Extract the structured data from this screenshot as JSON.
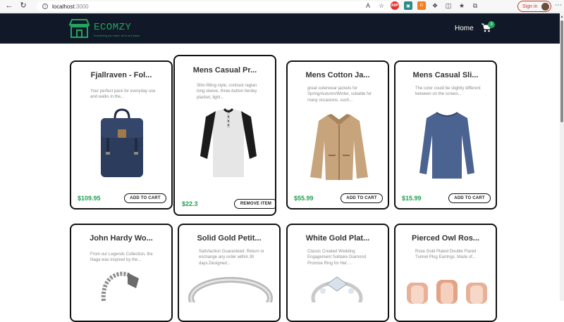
{
  "browser": {
    "url_host": "localhost",
    "url_port": ":3000",
    "signin_label": "Sign in",
    "ext_red": "ABP",
    "ext_teal": "▣",
    "ext_orange": "G"
  },
  "navbar": {
    "logo_name": "ECOMZY",
    "logo_tagline": "Everything you need, all in one place",
    "home_label": "Home",
    "cart_count": "3"
  },
  "products": [
    {
      "title": "Fjallraven - Fol...",
      "desc": "Your perfect pack for everyday use and walks in the...",
      "price": "$109.95",
      "button": "ADD TO CART"
    },
    {
      "title": "Mens Casual Pr...",
      "desc": "Slim-fitting style, contrast raglan long sleeve, three-button henley placket, light...",
      "price": "$22.3",
      "button": "REMOVE ITEM"
    },
    {
      "title": "Mens Cotton Ja...",
      "desc": "great outerwear jackets for Spring/Autumn/Winter, suitable for many occasions, such...",
      "price": "$55.99",
      "button": "ADD TO CART"
    },
    {
      "title": "Mens Casual Sli...",
      "desc": "The color could be slightly different between on the screen...",
      "price": "$15.99",
      "button": "ADD TO CART"
    },
    {
      "title": "John Hardy Wo...",
      "desc": "From our Legends Collection, the Naga was inspired by the...",
      "price": "",
      "button": ""
    },
    {
      "title": "Solid Gold Petit...",
      "desc": "Satisfaction Guaranteed. Return or exchange any order within 30 days.Designed...",
      "price": "",
      "button": ""
    },
    {
      "title": "White Gold Plat...",
      "desc": "Classic Created Wedding Engagement Solitaire Diamond Promise Ring for Her. ...",
      "price": "",
      "button": ""
    },
    {
      "title": "Pierced Owl Ros...",
      "desc": "Rose Gold Plated Double Flared Tunnel Plug Earrings. Made of...",
      "price": "",
      "button": ""
    }
  ],
  "colors": {
    "navbar_bg": "#111827",
    "brand_green": "#25a55f",
    "price_green": "#1f9f52"
  }
}
